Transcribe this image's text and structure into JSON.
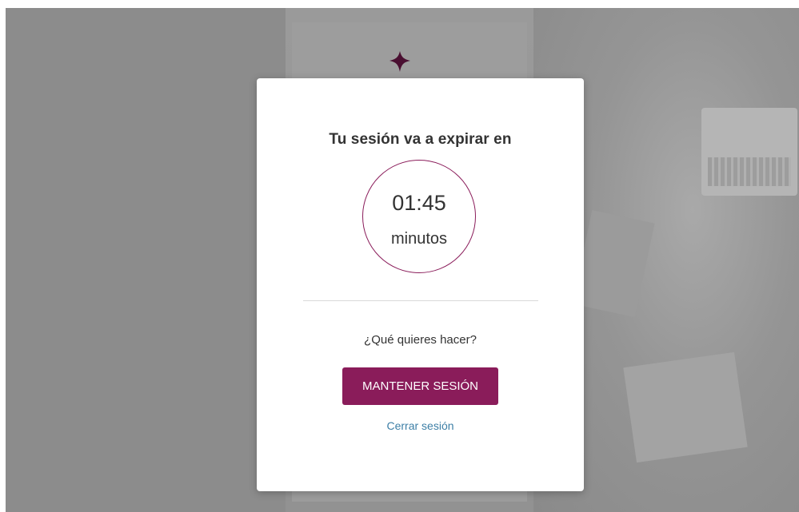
{
  "modal": {
    "title": "Tu sesión va a expirar en",
    "timer": {
      "value": "01:45",
      "unit": "minutos"
    },
    "question": "¿Qué quieres hacer?",
    "keep_session_label": "MANTENER SESIÓN",
    "logout_label": "Cerrar sesión"
  },
  "colors": {
    "accent": "#8a1c5a",
    "link": "#3d7fa6",
    "overlay": "#8a8a8a"
  },
  "icons": {
    "background_logo": "fleur-logo-icon"
  }
}
